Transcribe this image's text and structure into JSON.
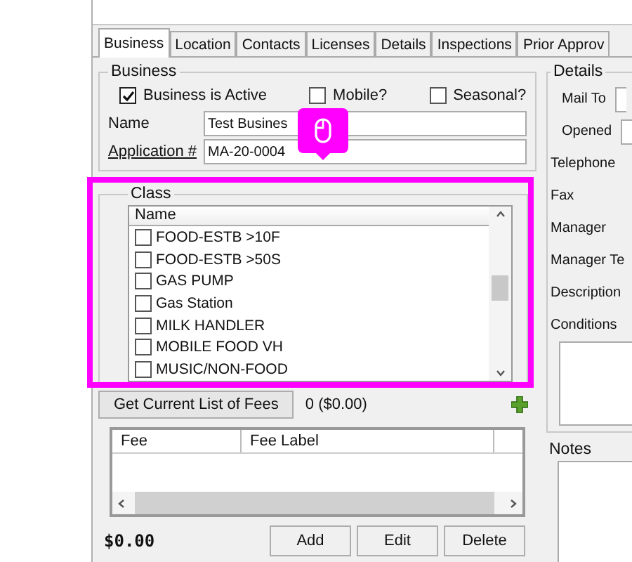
{
  "tabs": [
    {
      "label": "Business",
      "selected": true
    },
    {
      "label": "Location",
      "selected": false
    },
    {
      "label": "Contacts",
      "selected": false
    },
    {
      "label": "Licenses",
      "selected": false
    },
    {
      "label": "Details",
      "selected": false
    },
    {
      "label": "Inspections",
      "selected": false
    },
    {
      "label": "Prior Approv",
      "selected": false
    }
  ],
  "business": {
    "title": "Business",
    "checkboxes": [
      {
        "label": "Business is Active",
        "checked": true
      },
      {
        "label": "Mobile?",
        "checked": false
      },
      {
        "label": "Seasonal?",
        "checked": false
      }
    ],
    "fields": [
      {
        "label": "Name",
        "kind": "text",
        "value": "Test Busines"
      },
      {
        "label": "Application #",
        "kind": "link",
        "value": "MA-20-0004"
      }
    ]
  },
  "class": {
    "title": "Class",
    "column": "Name",
    "items": [
      {
        "label": "FOOD-ESTB >10F",
        "checked": false
      },
      {
        "label": "FOOD-ESTB >50S",
        "checked": false
      },
      {
        "label": "GAS PUMP",
        "checked": false
      },
      {
        "label": "Gas Station",
        "checked": false
      },
      {
        "label": "MILK HANDLER",
        "checked": false
      },
      {
        "label": "MOBILE FOOD VH",
        "checked": false
      },
      {
        "label": "MUSIC/NON-FOOD",
        "checked": false
      }
    ]
  },
  "fees": {
    "button": "Get Current List of Fees",
    "count": "0 ($0.00)",
    "columns": [
      "Fee",
      "Fee Label"
    ],
    "total": "$0.00",
    "buttons": [
      "Add",
      "Edit",
      "Delete"
    ]
  },
  "details": {
    "title": "Details",
    "fields": [
      {
        "label": "Mail To",
        "kind": "input"
      },
      {
        "label": "Opened",
        "kind": "input"
      },
      {
        "label": "Telephone",
        "kind": "text"
      },
      {
        "label": "Fax",
        "kind": "text"
      },
      {
        "label": "Manager",
        "kind": "text"
      },
      {
        "label": "Manager Te",
        "kind": "text"
      },
      {
        "label": "Description",
        "kind": "text"
      },
      {
        "label": "Conditions",
        "kind": "area"
      }
    ]
  },
  "notes": {
    "label": "Notes"
  }
}
